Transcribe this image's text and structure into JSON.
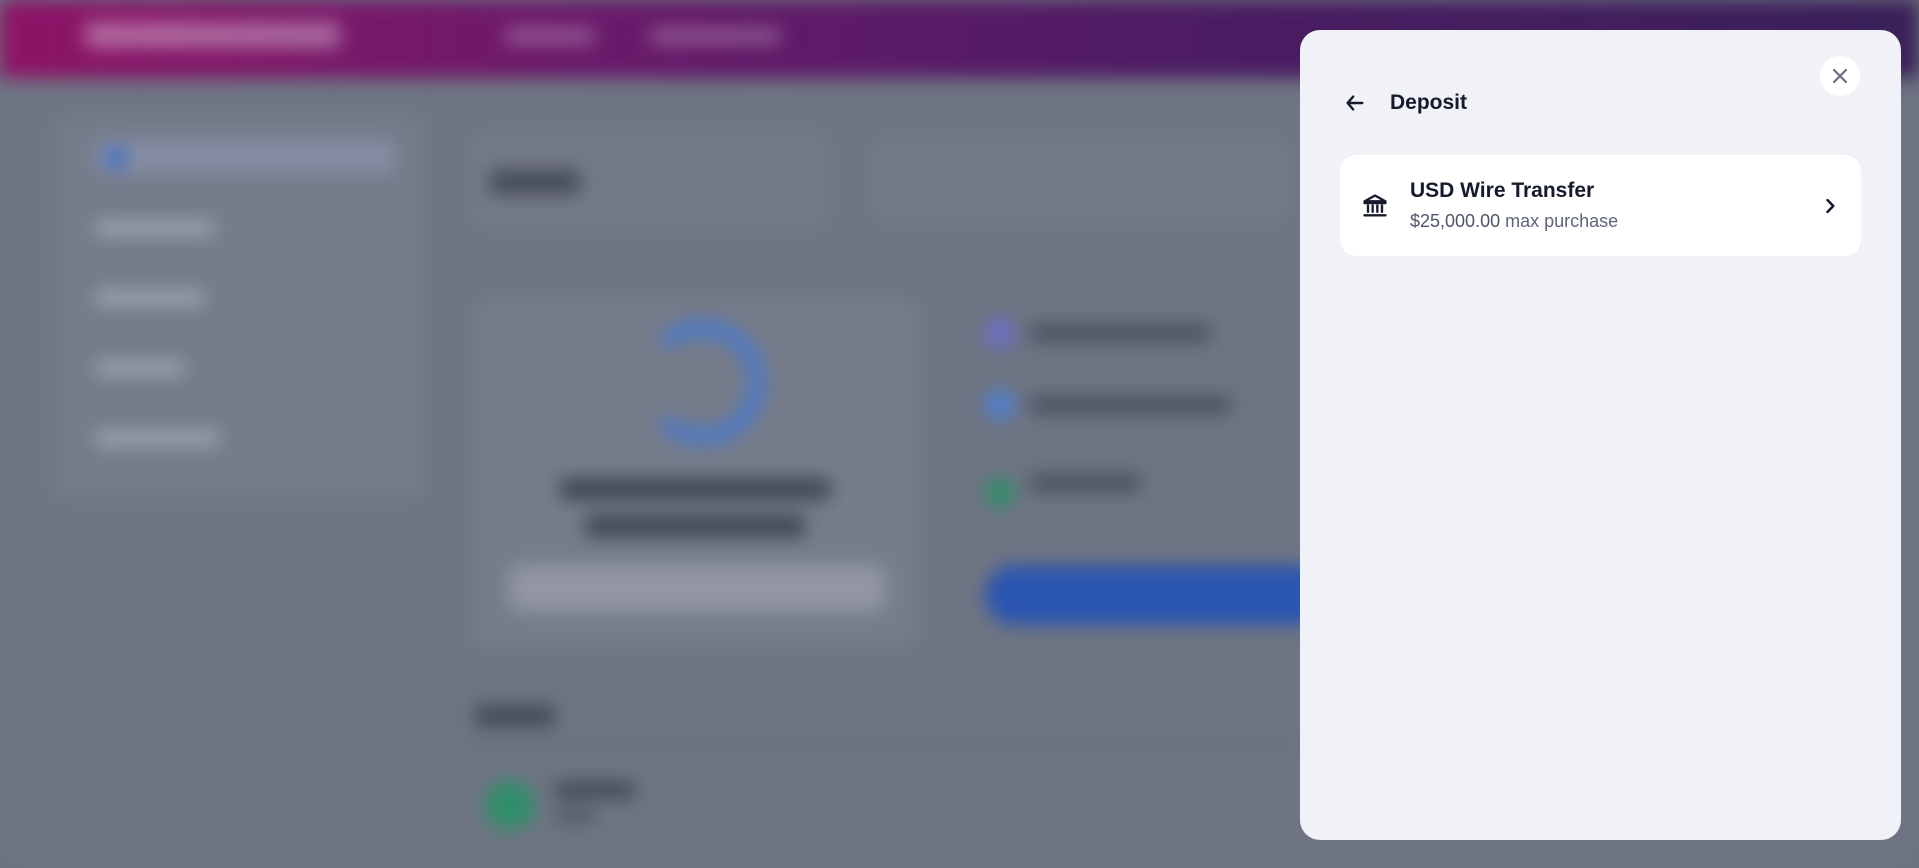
{
  "modal": {
    "title": "Deposit",
    "back_icon": "arrow-left-icon",
    "close_icon": "close-icon",
    "options": [
      {
        "icon": "bank-icon",
        "title": "USD Wire Transfer",
        "amount": "$25,000.00",
        "suffix": "max purchase"
      }
    ]
  },
  "colors": {
    "panel_background": "#f0f2f7",
    "card_background": "#ffffff",
    "text_primary": "#151a2d",
    "text_secondary": "#5d6579",
    "overlay": "#6b7280",
    "brand_gradient_start": "#8e1467",
    "brand_gradient_end": "#3a2158"
  }
}
